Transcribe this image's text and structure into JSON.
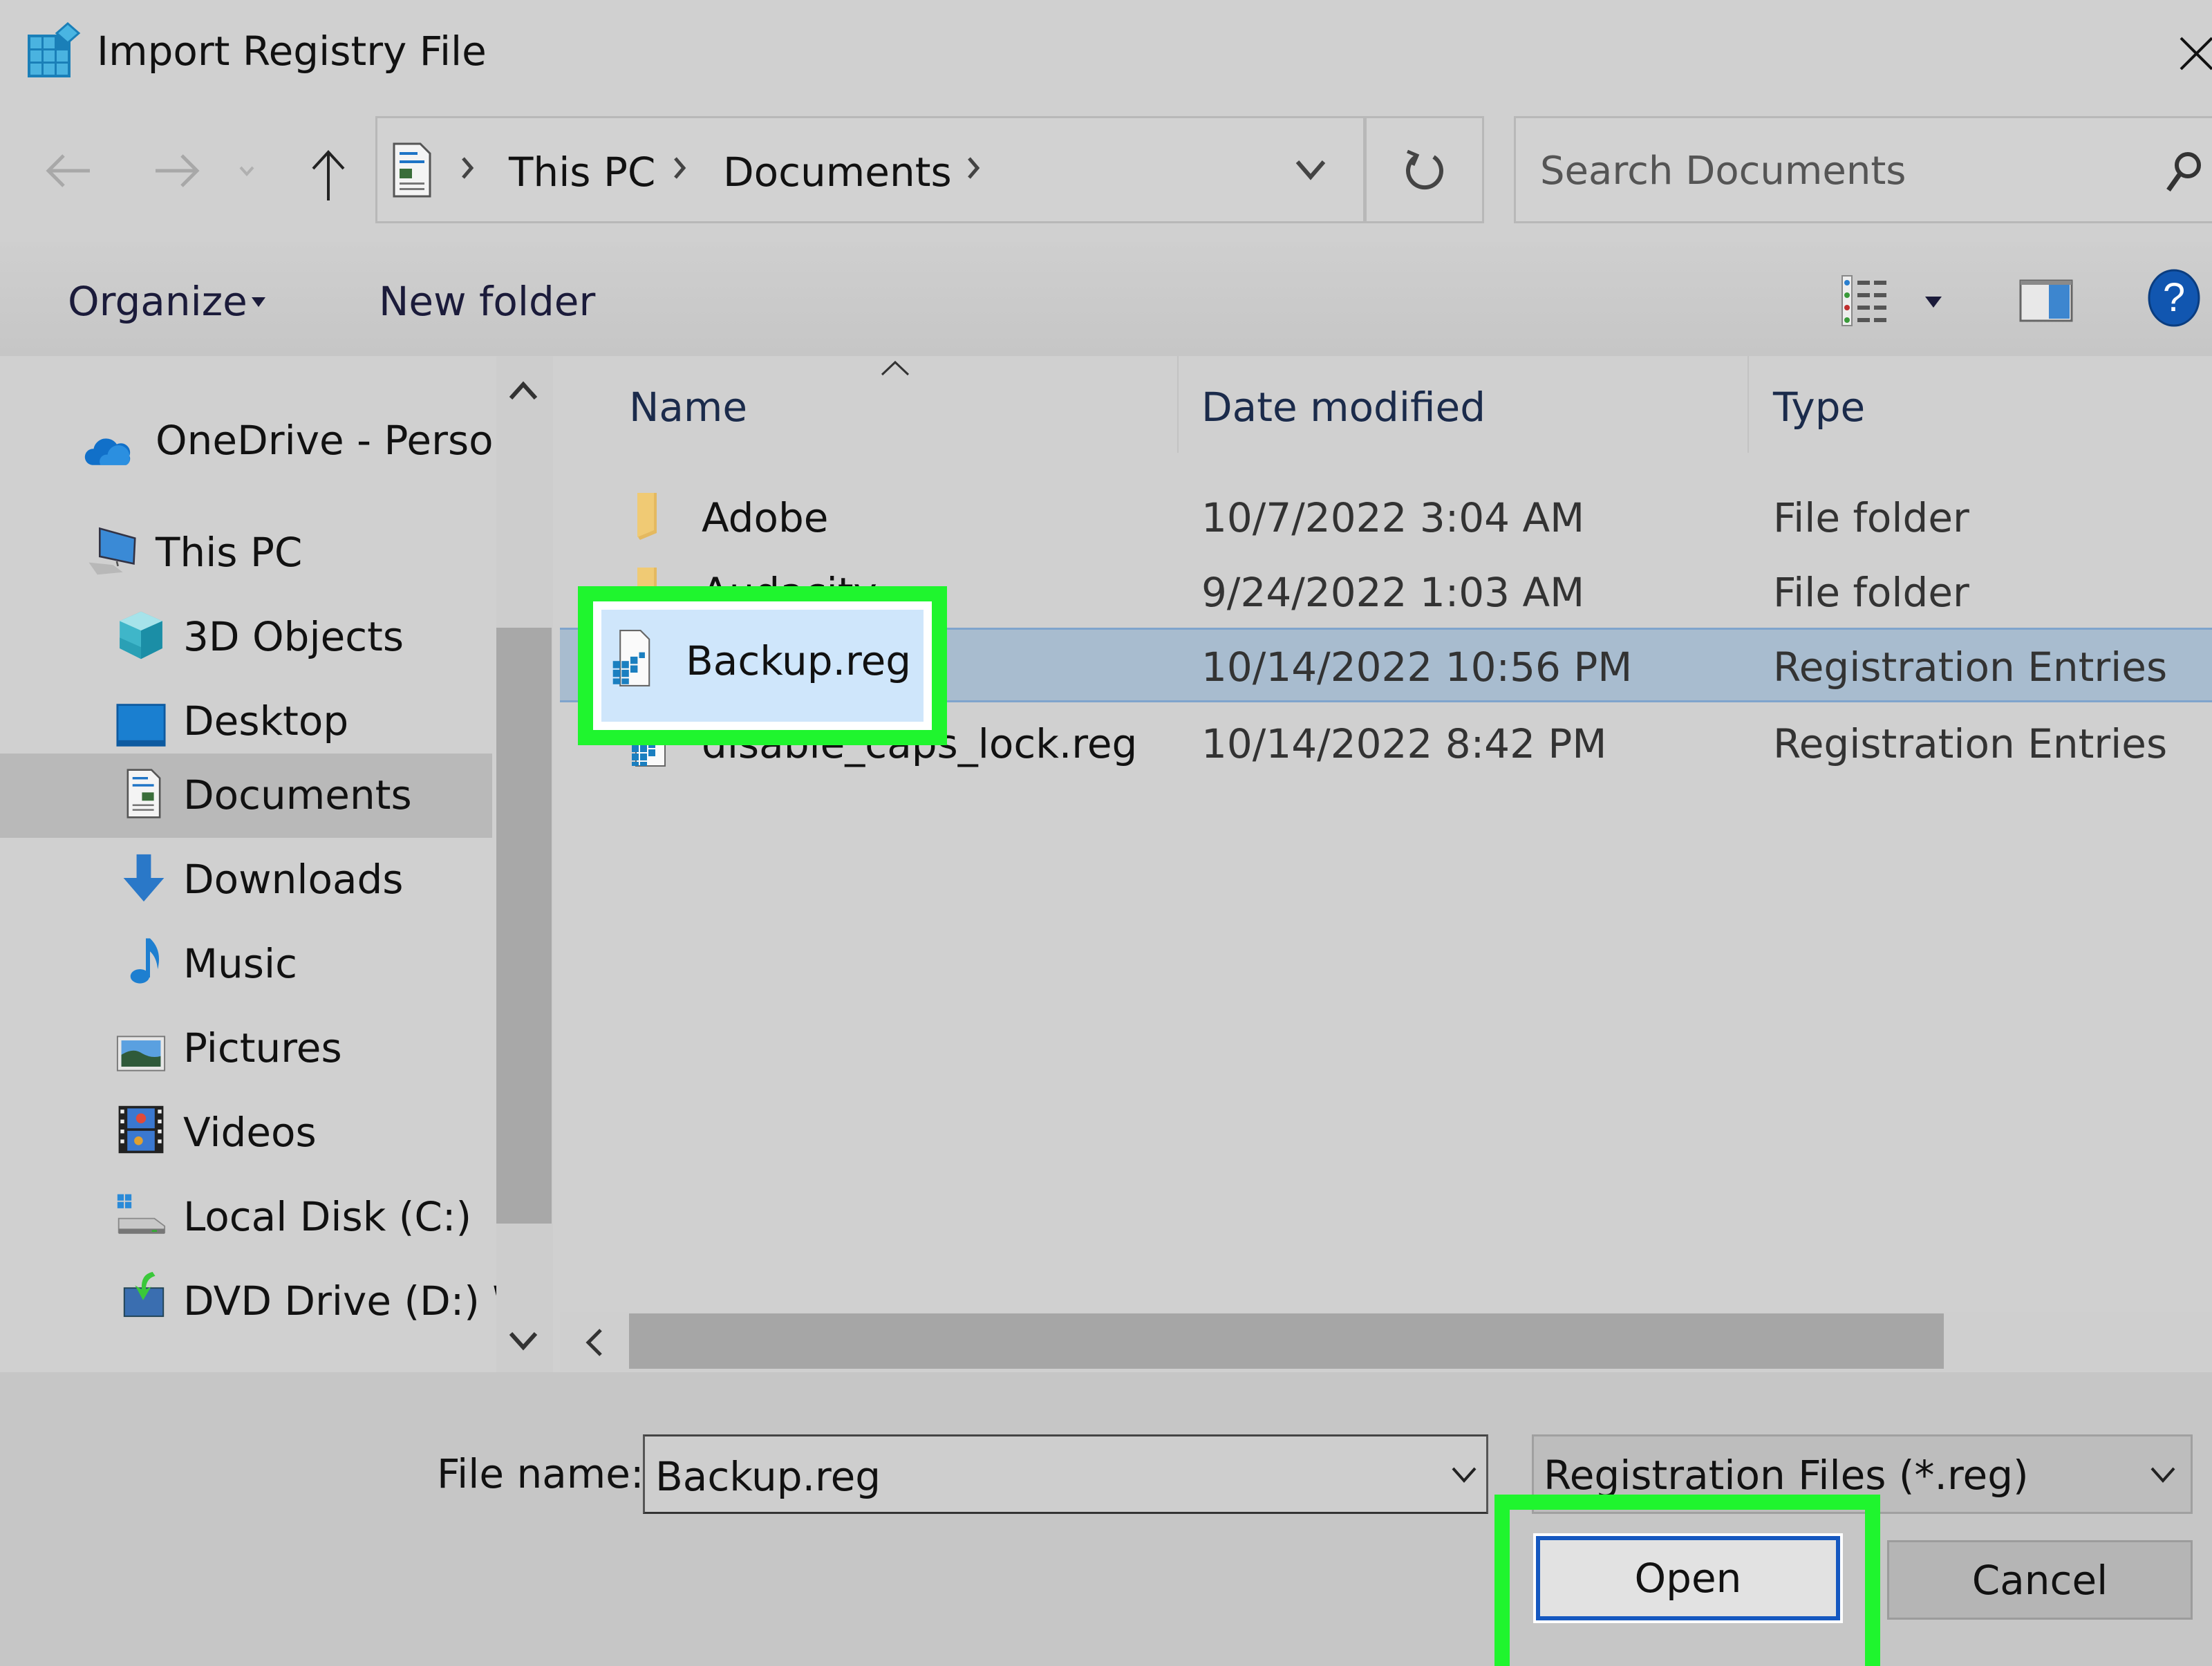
{
  "window": {
    "title": "Import Registry File",
    "icon": "registry-editor-icon",
    "close_icon": "close-icon"
  },
  "nav": {
    "back_icon": "arrow-left-icon",
    "forward_icon": "arrow-right-icon",
    "recent_icon": "chevron-down-icon",
    "up_icon": "arrow-up-icon",
    "breadcrumb": [
      "This PC",
      "Documents"
    ],
    "location_icon": "documents-icon",
    "refresh_icon": "refresh-icon",
    "search_placeholder": "Search Documents",
    "search_icon": "search-icon"
  },
  "toolbar": {
    "organize_label": "Organize",
    "new_folder_label": "New folder",
    "view_icon": "details-view-icon",
    "preview_icon": "preview-pane-icon",
    "help_icon": "help-icon",
    "help_glyph": "?"
  },
  "sidebar": {
    "items": [
      {
        "label": "OneDrive - Person",
        "icon": "onedrive-cloud-icon"
      },
      {
        "label": "This PC",
        "icon": "computer-icon"
      },
      {
        "label": "3D Objects",
        "icon": "3d-objects-icon"
      },
      {
        "label": "Desktop",
        "icon": "desktop-icon"
      },
      {
        "label": "Documents",
        "icon": "documents-icon",
        "selected": true
      },
      {
        "label": "Downloads",
        "icon": "downloads-arrow-icon"
      },
      {
        "label": "Music",
        "icon": "music-note-icon"
      },
      {
        "label": "Pictures",
        "icon": "pictures-icon"
      },
      {
        "label": "Videos",
        "icon": "videos-film-icon"
      },
      {
        "label": "Local Disk (C:)",
        "icon": "local-disk-icon"
      },
      {
        "label": "DVD Drive (D:) W",
        "icon": "dvd-drive-icon"
      }
    ]
  },
  "file_list": {
    "columns": [
      "Name",
      "Date modified",
      "Type"
    ],
    "sort_column": "Name",
    "rows": [
      {
        "name": "Adobe",
        "date": "10/7/2022 3:04 AM",
        "type": "File folder",
        "icon": "folder-icon"
      },
      {
        "name": "Audacity",
        "date": "9/24/2022 1:03 AM",
        "type": "File folder",
        "icon": "folder-icon"
      },
      {
        "name": "Backup.reg",
        "date": "10/14/2022 10:56 PM",
        "type": "Registration Entries",
        "icon": "registry-file-icon",
        "selected": true
      },
      {
        "name": "disable_caps_lock.reg",
        "date": "10/14/2022 8:42 PM",
        "type": "Registration Entries",
        "icon": "registry-file-icon"
      }
    ]
  },
  "bottom": {
    "file_name_label": "File name:",
    "file_name_value": "Backup.reg",
    "file_type_value": "Registration Files (*.reg)",
    "open_label": "Open",
    "cancel_label": "Cancel"
  },
  "annotations": {
    "highlight_color": "#1ff52e",
    "highlighted": [
      "Backup.reg",
      "Open"
    ]
  }
}
